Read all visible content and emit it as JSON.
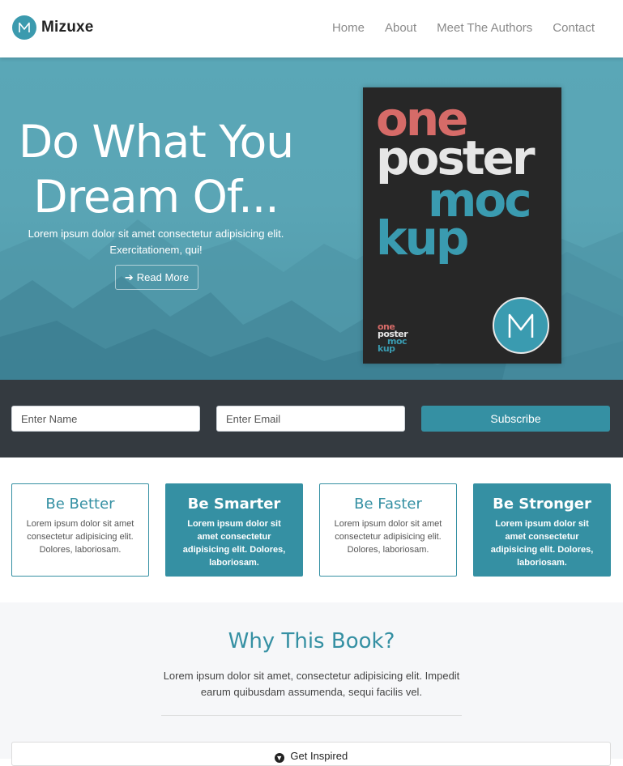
{
  "brand": {
    "logo_letter": "M",
    "name": "Mizuxe"
  },
  "nav": {
    "items": [
      {
        "label": "Home"
      },
      {
        "label": "About"
      },
      {
        "label": "Meet The Authors"
      },
      {
        "label": "Contact"
      }
    ]
  },
  "hero": {
    "title_line1": "Do What You",
    "title_line2": "Dream Of...",
    "subtitle_line1": "Lorem ipsum dolor sit amet consectetur adipisicing elit.",
    "subtitle_line2": "Exercitationem, qui!",
    "read_more_icon": "arrow-right-icon",
    "read_more_label": "Read More",
    "poster": {
      "line1": "one",
      "line2": "poster",
      "line3": "moc",
      "line4": "kup",
      "logo_letter": "M"
    }
  },
  "subscribe": {
    "name_placeholder": "Enter Name",
    "email_placeholder": "Enter Email",
    "button_label": "Subscribe"
  },
  "features": [
    {
      "title": "Be Better",
      "text": "Lorem ipsum dolor sit amet consectetur adipisicing elit. Dolores, laboriosam.",
      "style": "light"
    },
    {
      "title": "Be Smarter",
      "text": "Lorem ipsum dolor sit amet consectetur adipisicing elit. Dolores, laboriosam.",
      "style": "dark"
    },
    {
      "title": "Be Faster",
      "text": "Lorem ipsum dolor sit amet consectetur adipisicing elit. Dolores, laboriosam.",
      "style": "light"
    },
    {
      "title": "Be Stronger",
      "text": "Lorem ipsum dolor sit amet consectetur adipisicing elit. Dolores, laboriosam.",
      "style": "dark"
    }
  ],
  "why": {
    "title": "Why This Book?",
    "text": "Lorem ipsum dolor sit amet, consectetur adipisicing elit. Impedit earum quibusdam assumenda, sequi facilis vel.",
    "accordion_icon": "chevron-circle-down-icon",
    "accordion_label": "Get Inspired"
  },
  "colors": {
    "primary": "#3590a3",
    "hero_bg": "#5aa7b7",
    "dark_bar": "#343a40",
    "poster_bg": "#272727",
    "poster_red": "#d66b68"
  }
}
